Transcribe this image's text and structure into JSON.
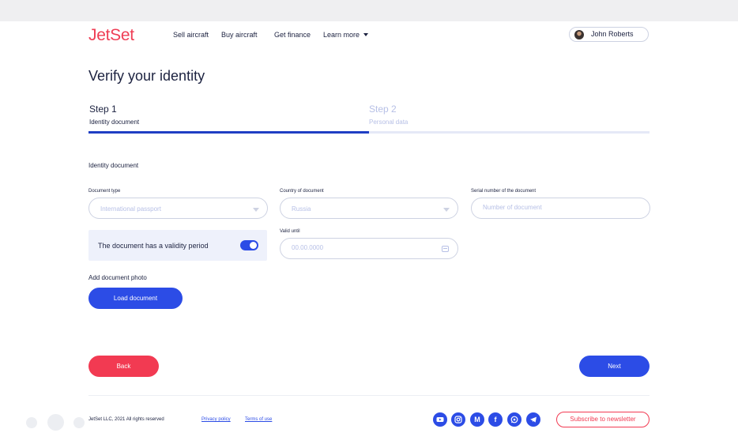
{
  "header": {
    "logo": "JetSet",
    "nav": [
      "Sell aircraft",
      "Buy aircraft",
      "Get finance",
      "Learn more"
    ],
    "user_name": "John Roberts"
  },
  "page": {
    "title": "Verify your identity"
  },
  "steps": [
    {
      "label": "Step 1",
      "sub": "Identity document",
      "active": true
    },
    {
      "label": "Step 2",
      "sub": "Personal data",
      "active": false
    }
  ],
  "progress": {
    "fraction": 0.5
  },
  "form": {
    "section_title": "Identity document",
    "document_type": {
      "label": "Document type",
      "value": "International passport"
    },
    "country": {
      "label": "Country of document",
      "value": "Russia"
    },
    "serial": {
      "label": "Serial number of the document",
      "placeholder": "Number of document"
    },
    "validity": {
      "label": "The document has a validity period",
      "enabled": true
    },
    "valid_until": {
      "label": "Valid until",
      "placeholder": "00.00.0000"
    },
    "photo_label": "Add document photo",
    "load_button": "Load document"
  },
  "actions": {
    "back": "Back",
    "next": "Next"
  },
  "footer": {
    "copyright": "JetSet LLC, 2021 All rights reserved",
    "privacy": "Privacy policy",
    "terms": "Terms of use",
    "social_icons": [
      "youtube-icon",
      "instagram-icon",
      "medium-icon",
      "facebook-icon",
      "whatsapp-icon",
      "telegram-icon"
    ],
    "medium_letter": "M",
    "facebook_letter": "f",
    "subscribe": "Subscribe to newsletter"
  },
  "colors": {
    "brand_red": "#f23a52",
    "accent_blue": "#2c4ce6",
    "text_dark": "#1c2240",
    "placeholder": "#b7c0e6"
  }
}
